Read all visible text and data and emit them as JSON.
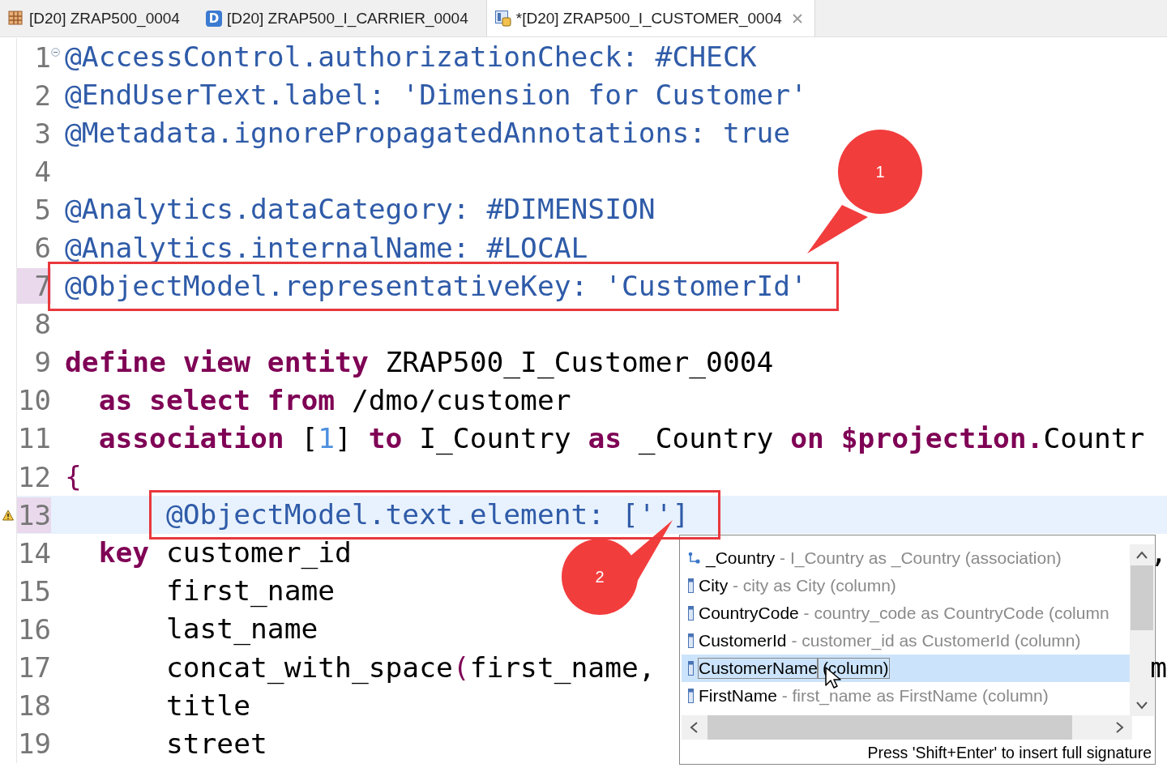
{
  "tabs": [
    {
      "label": "[D20] ZRAP500_0004",
      "selected": false
    },
    {
      "label": "[D20] ZRAP500_I_CARRIER_0004",
      "badge": "D",
      "selected": false
    },
    {
      "label": "*[D20] ZRAP500_I_CUSTOMER_0004",
      "selected": true
    }
  ],
  "editor": {
    "lines": [
      {
        "number": "1",
        "foldable": true,
        "marked": false,
        "current": false,
        "warning": false,
        "tokens": [
          {
            "kind": "annotation",
            "text": "@AccessControl.authorizationCheck: #CHECK"
          }
        ]
      },
      {
        "number": "2",
        "foldable": false,
        "marked": false,
        "current": false,
        "warning": false,
        "tokens": [
          {
            "kind": "annotation",
            "text": "@EndUserText.label: 'Dimension for Customer'"
          }
        ]
      },
      {
        "number": "3",
        "foldable": false,
        "marked": false,
        "current": false,
        "warning": false,
        "tokens": [
          {
            "kind": "annotation",
            "text": "@Metadata.ignorePropagatedAnnotations: true"
          }
        ]
      },
      {
        "number": "4",
        "foldable": false,
        "marked": false,
        "current": false,
        "warning": false
      },
      {
        "number": "5",
        "foldable": false,
        "marked": false,
        "current": false,
        "warning": false,
        "tokens": [
          {
            "kind": "annotation",
            "text": "@Analytics.dataCategory: #DIMENSION"
          }
        ]
      },
      {
        "number": "6",
        "foldable": false,
        "marked": false,
        "current": false,
        "warning": false,
        "tokens": [
          {
            "kind": "annotation",
            "text": "@Analytics.internalName: #LOCAL"
          }
        ]
      },
      {
        "number": "7",
        "framed": true,
        "foldable": false,
        "marked": true,
        "current": false,
        "warning": false,
        "tokens": [
          {
            "kind": "annotation",
            "text": "@ObjectModel.representativeKey: 'CustomerId'"
          }
        ]
      },
      {
        "number": "8",
        "foldable": false,
        "marked": false,
        "current": false,
        "warning": false
      },
      {
        "number": "9",
        "foldable": false,
        "marked": false,
        "current": false,
        "warning": false,
        "tokens": [
          {
            "kind": "keyword",
            "text": "define view entity"
          },
          {
            "kind": "plain",
            "text": " ZRAP500_I_Customer_0004"
          }
        ]
      },
      {
        "number": "10",
        "foldable": false,
        "marked": false,
        "current": false,
        "warning": false,
        "tokens": [
          {
            "kind": "keyword",
            "text": "  as select from"
          },
          {
            "kind": "plain",
            "text": " /dmo/customer"
          }
        ]
      },
      {
        "number": "11",
        "foldable": false,
        "marked": false,
        "current": false,
        "warning": false,
        "tokens": [
          {
            "kind": "keyword",
            "text": "  association"
          },
          {
            "kind": "plain",
            "text": " ["
          },
          {
            "kind": "number",
            "text": "1"
          },
          {
            "kind": "plain",
            "text": "] "
          },
          {
            "kind": "keyword",
            "text": "to"
          },
          {
            "kind": "plain",
            "text": " I_Country "
          },
          {
            "kind": "keyword",
            "text": "as"
          },
          {
            "kind": "plain",
            "text": " _Country "
          },
          {
            "kind": "keyword",
            "text": "on $projection."
          },
          {
            "kind": "plain",
            "text": "Countr"
          }
        ]
      },
      {
        "number": "12",
        "foldable": false,
        "marked": false,
        "current": false,
        "warning": false,
        "tokens": [
          {
            "kind": "punct",
            "text": "{"
          }
        ]
      },
      {
        "number": "13",
        "framed": true,
        "foldable": false,
        "marked": true,
        "current": true,
        "warning": true,
        "tokens": [
          {
            "kind": "annotation",
            "text": "      @ObjectModel.text.element: ['']"
          }
        ]
      },
      {
        "number": "14",
        "foldable": false,
        "marked": false,
        "current": false,
        "warning": false,
        "tokens": [
          {
            "kind": "keyword",
            "text": "  key"
          },
          {
            "kind": "plain",
            "text": " customer_id"
          }
        ],
        "edge_fragment": ","
      },
      {
        "number": "15",
        "foldable": false,
        "marked": false,
        "current": false,
        "warning": false,
        "tokens": [
          {
            "kind": "plain",
            "text": "      first_name"
          }
        ]
      },
      {
        "number": "16",
        "foldable": false,
        "marked": false,
        "current": false,
        "warning": false,
        "tokens": [
          {
            "kind": "plain",
            "text": "      last_name"
          }
        ]
      },
      {
        "number": "17",
        "foldable": false,
        "marked": false,
        "current": false,
        "warning": false,
        "tokens": [
          {
            "kind": "plain",
            "text": "      concat_with_space"
          },
          {
            "kind": "punct",
            "text": "("
          },
          {
            "kind": "plain",
            "text": "first_name,"
          }
        ],
        "edge_fragment": "m"
      },
      {
        "number": "18",
        "foldable": false,
        "marked": false,
        "current": false,
        "warning": false,
        "tokens": [
          {
            "kind": "plain",
            "text": "      title"
          }
        ]
      },
      {
        "number": "19",
        "foldable": false,
        "marked": false,
        "current": false,
        "warning": false,
        "tokens": [
          {
            "kind": "plain",
            "text": "      street"
          }
        ]
      }
    ]
  },
  "completion_popup": {
    "items": [
      {
        "kind": "association",
        "name": "_Country",
        "detail": " - I_Country as _Country (association)",
        "selected": false
      },
      {
        "kind": "column",
        "name": "City",
        "detail": " - city as City (column)",
        "selected": false
      },
      {
        "kind": "column",
        "name": "CountryCode",
        "detail": " - country_code as CountryCode (column",
        "selected": false
      },
      {
        "kind": "column",
        "name": "CustomerId",
        "detail": " - customer_id as CustomerId (column)",
        "selected": false
      },
      {
        "kind": "column",
        "name": "CustomerName",
        "detail": " (column)",
        "selected": true
      },
      {
        "kind": "column",
        "name": "FirstName",
        "detail": " - first_name as FirstName (column)",
        "selected": false
      }
    ],
    "hint": "Press 'Shift+Enter' to insert full signature"
  },
  "callouts": [
    {
      "label": "1"
    },
    {
      "label": "2"
    }
  ]
}
